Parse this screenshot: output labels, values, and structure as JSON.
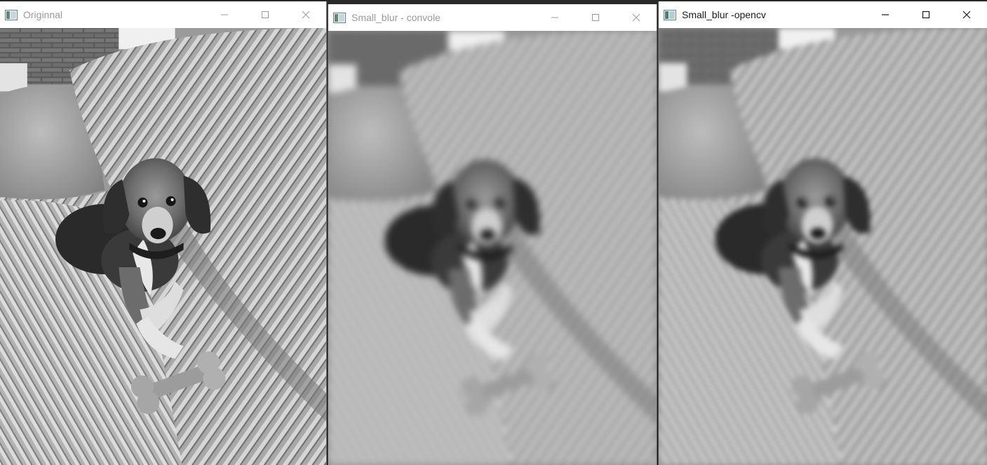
{
  "windows": [
    {
      "title": "Originnal",
      "active": false,
      "icon": "image-window-icon",
      "content": "grayscale-photo-beagle"
    },
    {
      "title": "Small_blur - convole",
      "active": false,
      "icon": "image-window-icon",
      "content": "grayscale-photo-beagle-blurred"
    },
    {
      "title": "Small_blur -opencv",
      "active": true,
      "icon": "image-window-icon",
      "content": "grayscale-photo-beagle-blurred"
    }
  ],
  "controls": {
    "minimize_icon": "minimize-icon",
    "maximize_icon": "maximize-icon",
    "close_icon": "close-icon"
  },
  "colors": {
    "titlebar_bg": "#ffffff",
    "inactive_title_text": "#9a9a9a",
    "active_title_text": "#1b1b1b",
    "image_tone": "grayscale"
  }
}
